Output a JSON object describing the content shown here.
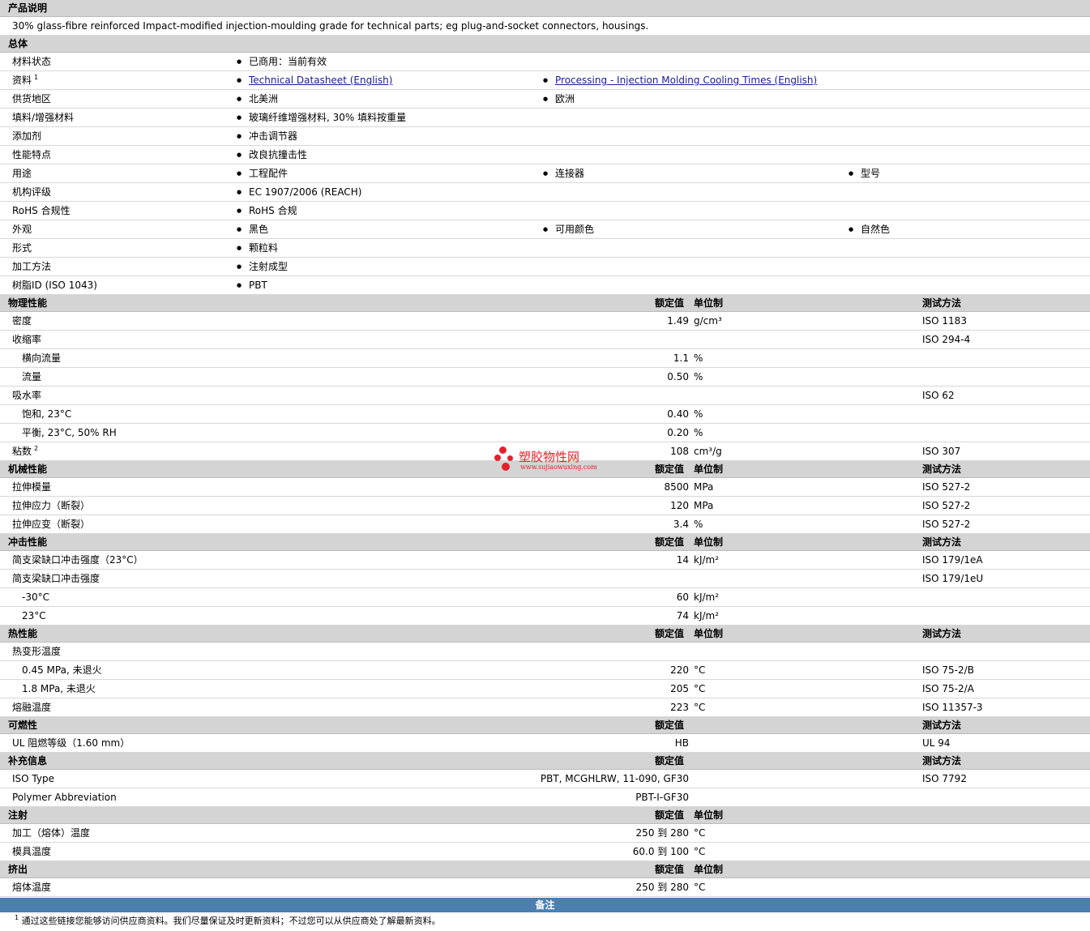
{
  "description": {
    "header": "产品说明",
    "text": "30% glass-fibre reinforced Impact-modified injection-moulding grade for technical parts; eg plug-and-socket connectors, housings."
  },
  "general": {
    "header": "总体",
    "rows": [
      {
        "label": "材料状态",
        "items": [
          "已商用：当前有效"
        ]
      },
      {
        "label": "资料",
        "sup": "1",
        "items": [
          "Technical Datasheet (English)",
          "Processing - Injection Molding Cooling Times (English)"
        ],
        "links": true
      },
      {
        "label": "供货地区",
        "items": [
          "北美洲",
          "欧洲"
        ]
      },
      {
        "label": "填料/增强材料",
        "items": [
          "玻璃纤维增强材料, 30% 填料按重量"
        ]
      },
      {
        "label": "添加剂",
        "items": [
          "冲击调节器"
        ]
      },
      {
        "label": "性能特点",
        "items": [
          "改良抗撞击性"
        ]
      },
      {
        "label": "用途",
        "items": [
          "工程配件",
          "连接器",
          "型号"
        ]
      },
      {
        "label": "机构评级",
        "items": [
          "EC 1907/2006 (REACH)"
        ]
      },
      {
        "label": "RoHS 合规性",
        "items": [
          "RoHS 合规"
        ]
      },
      {
        "label": "外观",
        "items": [
          "黑色",
          "可用颜色",
          "自然色"
        ]
      },
      {
        "label": "形式",
        "items": [
          "颗粒料"
        ]
      },
      {
        "label": "加工方法",
        "items": [
          "注射成型"
        ]
      },
      {
        "label": "树脂ID (ISO 1043)",
        "items": [
          "PBT"
        ]
      }
    ]
  },
  "columns": {
    "value": "额定值",
    "unit": "单位制",
    "test": "测试方法"
  },
  "sections": [
    {
      "header": "物理性能",
      "show_unit": true,
      "show_test": true,
      "rows": [
        {
          "label": "密度",
          "value": "1.49",
          "unit": "g/cm³",
          "test": "ISO 1183"
        },
        {
          "label": "收缩率",
          "value": "",
          "unit": "",
          "test": "ISO 294-4"
        },
        {
          "label": "横向流量",
          "sub": true,
          "value": "1.1",
          "unit": "%",
          "test": ""
        },
        {
          "label": "流量",
          "sub": true,
          "value": "0.50",
          "unit": "%",
          "test": ""
        },
        {
          "label": "吸水率",
          "value": "",
          "unit": "",
          "test": "ISO 62"
        },
        {
          "label": "饱和, 23°C",
          "sub": true,
          "value": "0.40",
          "unit": "%",
          "test": ""
        },
        {
          "label": "平衡, 23°C, 50% RH",
          "sub": true,
          "value": "0.20",
          "unit": "%",
          "test": ""
        },
        {
          "label": "粘数",
          "sup": "2",
          "value": "108",
          "unit": "cm³/g",
          "test": "ISO 307"
        }
      ]
    },
    {
      "header": "机械性能",
      "show_unit": true,
      "show_test": true,
      "rows": [
        {
          "label": "拉伸模量",
          "value": "8500",
          "unit": "MPa",
          "test": "ISO 527-2"
        },
        {
          "label": "拉伸应力（断裂）",
          "value": "120",
          "unit": "MPa",
          "test": "ISO 527-2"
        },
        {
          "label": "拉伸应变（断裂）",
          "value": "3.4",
          "unit": "%",
          "test": "ISO 527-2"
        }
      ]
    },
    {
      "header": "冲击性能",
      "show_unit": true,
      "show_test": true,
      "rows": [
        {
          "label": "简支梁缺口冲击强度（23°C）",
          "value": "14",
          "unit": "kJ/m²",
          "test": "ISO 179/1eA"
        },
        {
          "label": "简支梁缺口冲击强度",
          "value": "",
          "unit": "",
          "test": "ISO 179/1eU"
        },
        {
          "label": "-30°C",
          "sub": true,
          "value": "60",
          "unit": "kJ/m²",
          "test": ""
        },
        {
          "label": "23°C",
          "sub": true,
          "value": "74",
          "unit": "kJ/m²",
          "test": ""
        }
      ]
    },
    {
      "header": "热性能",
      "show_unit": true,
      "show_test": true,
      "rows": [
        {
          "label": "热变形温度",
          "value": "",
          "unit": "",
          "test": ""
        },
        {
          "label": "0.45 MPa, 未退火",
          "sub": true,
          "value": "220",
          "unit": "°C",
          "test": "ISO 75-2/B"
        },
        {
          "label": "1.8 MPa, 未退火",
          "sub": true,
          "value": "205",
          "unit": "°C",
          "test": "ISO 75-2/A"
        },
        {
          "label": "熔融温度",
          "value": "223",
          "unit": "°C",
          "test": "ISO 11357-3"
        }
      ]
    },
    {
      "header": "可燃性",
      "show_unit": false,
      "show_test": true,
      "rows": [
        {
          "label": "UL 阻燃等级（1.60 mm）",
          "value": "HB",
          "unit": "",
          "test": "UL 94"
        }
      ]
    },
    {
      "header": "补充信息",
      "show_unit": false,
      "show_test": true,
      "rows": [
        {
          "label": "ISO Type",
          "value": "PBT, MCGHLRW, 11-090, GF30",
          "unit": "",
          "test": "ISO 7792"
        },
        {
          "label": "Polymer Abbreviation",
          "value": "PBT-I-GF30",
          "unit": "",
          "test": ""
        }
      ]
    },
    {
      "header": "注射",
      "show_unit": true,
      "show_test": false,
      "rows": [
        {
          "label": "加工（熔体）温度",
          "value": "250 到  280",
          "unit": "°C",
          "test": ""
        },
        {
          "label": "模具温度",
          "value": "60.0 到  100",
          "unit": "°C",
          "test": ""
        }
      ]
    },
    {
      "header": "挤出",
      "show_unit": true,
      "show_test": false,
      "rows": [
        {
          "label": "熔体温度",
          "value": "250 到  280",
          "unit": "°C",
          "test": ""
        }
      ]
    }
  ],
  "notes": {
    "header": "备注",
    "items": [
      {
        "num": "1",
        "text": "通过这些链接您能够访问供应商资料。我们尽量保证及时更新资料；不过您可以从供应商处了解最新资料。"
      }
    ]
  },
  "watermark": {
    "name": "塑胶物性网",
    "url": "www.sujiaowuxing.com",
    "color": "#e5202d"
  }
}
